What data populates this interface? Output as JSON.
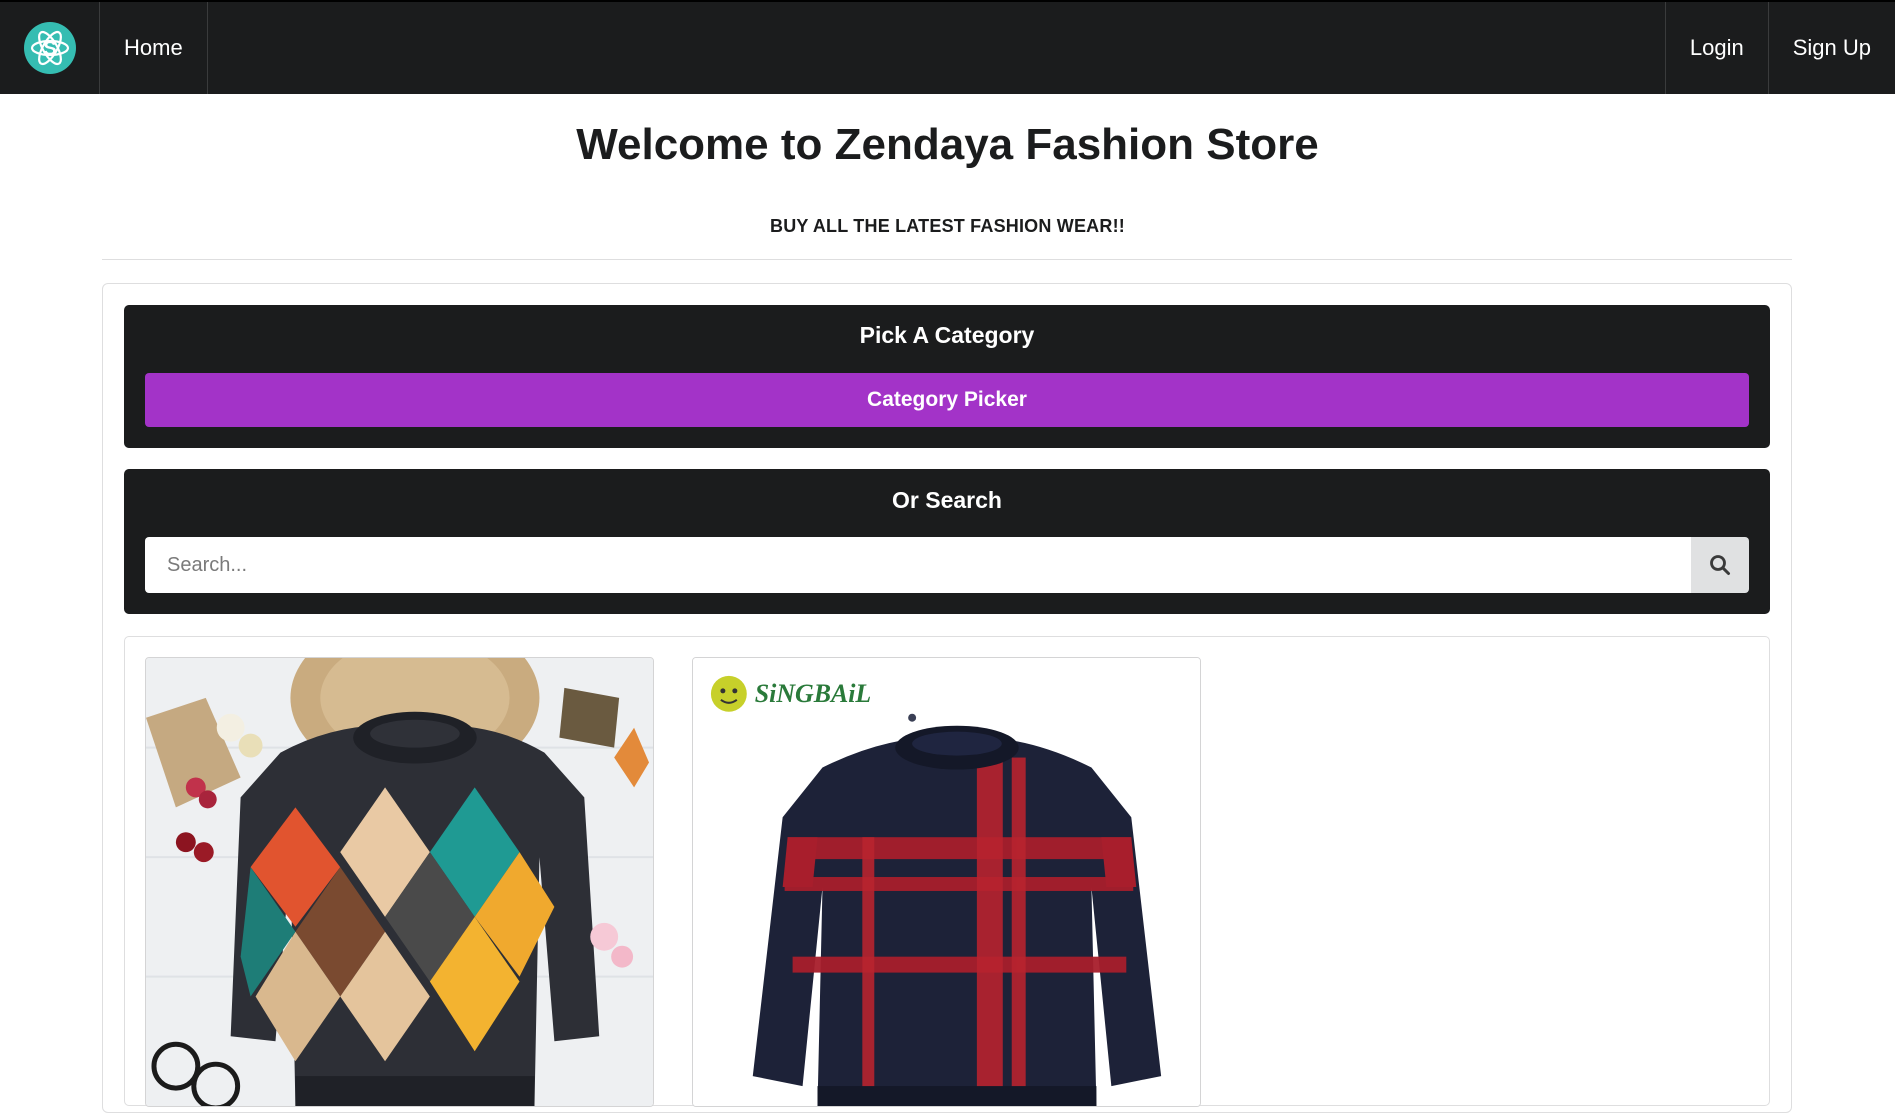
{
  "navbar": {
    "logo_icon": "atom-s-logo-icon",
    "home_label": "Home",
    "login_label": "Login",
    "signup_label": "Sign Up"
  },
  "hero": {
    "title": "Welcome to Zendaya Fashion Store",
    "subtitle": "BUY ALL THE LATEST FASHION WEAR!!"
  },
  "category_section": {
    "heading": "Pick A Category",
    "button_label": "Category Picker",
    "button_color": "#a333c8"
  },
  "search_section": {
    "heading": "Or Search",
    "placeholder": "Search...",
    "value": "",
    "button_icon": "search-icon"
  },
  "products": [
    {
      "image": "argyle-sweater-photo"
    },
    {
      "image": "plaid-sweater-photo",
      "brand_logo_text": "SiNGBAiL"
    }
  ],
  "colors": {
    "navbar_bg": "#1b1c1d",
    "logo_teal": "#35bdb2",
    "panel_bg": "#1b1c1d"
  }
}
